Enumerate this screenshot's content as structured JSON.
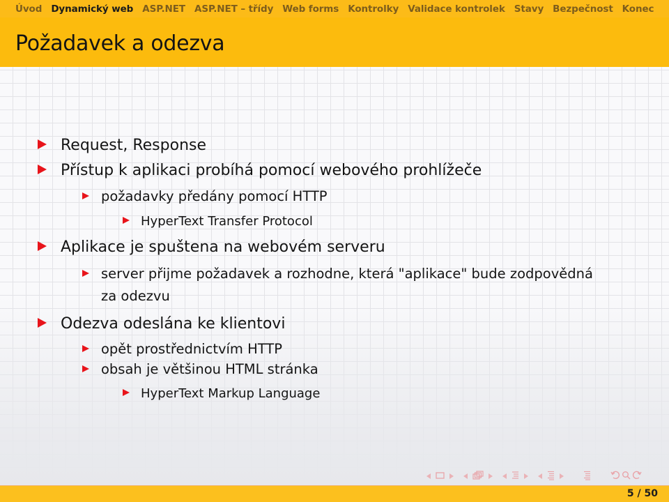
{
  "headline": {
    "sections": [
      {
        "label": "Úvod",
        "active": false
      },
      {
        "label": "Dynamický web",
        "active": true
      },
      {
        "label": "ASP.NET",
        "active": false
      },
      {
        "label": "ASP.NET – třídy",
        "active": false
      },
      {
        "label": "Web forms",
        "active": false
      },
      {
        "label": "Kontrolky",
        "active": false
      },
      {
        "label": "Validace kontrolek",
        "active": false
      },
      {
        "label": "Stavy",
        "active": false
      },
      {
        "label": "Bezpečnost",
        "active": false
      },
      {
        "label": "Konec",
        "active": false
      }
    ]
  },
  "frame": {
    "title": "Požadavek a odezva"
  },
  "bullets": [
    {
      "level": 1,
      "text": "Request, Response"
    },
    {
      "level": 1,
      "text": "Přístup k aplikaci probíhá pomocí webového prohlížeče"
    },
    {
      "level": 2,
      "text": "požadavky předány pomocí HTTP"
    },
    {
      "level": 3,
      "text": "HyperText Transfer Protocol"
    },
    {
      "level": 1,
      "text": "Aplikace je spuštena na webovém serveru"
    },
    {
      "level": 2,
      "text": "server přijme požadavek a rozhodne, která \"aplikace\" bude zodpovědná",
      "continuation": "za odezvu"
    },
    {
      "level": 1,
      "text": "Odezva odeslána ke klientovi"
    },
    {
      "level": 2,
      "text": "opět prostřednictvím HTTP"
    },
    {
      "level": 2,
      "text": "obsah je většinou HTML stránka"
    },
    {
      "level": 3,
      "text": "HyperText Markup Language"
    }
  ],
  "navigation": {
    "icons": [
      "frame-prev-icon",
      "frame-icon",
      "frame-next-icon",
      "subsection-prev-icon",
      "subsection-icon",
      "subsection-next-icon",
      "section-prev-icon",
      "section-icon",
      "section-next-icon",
      "document-prev-icon",
      "document-icon",
      "document-next-icon",
      "appendix-icon",
      "back-icon",
      "search-icon",
      "forward-icon"
    ]
  },
  "footer": {
    "page_current": "5",
    "page_separator": "/",
    "page_total": "50",
    "page_label": "5 / 50"
  },
  "colors": {
    "theme_yellow": "#fcbb18",
    "bullet_red": "#e8141b",
    "inactive_section": "#7d5d1c",
    "text": "#141414"
  }
}
